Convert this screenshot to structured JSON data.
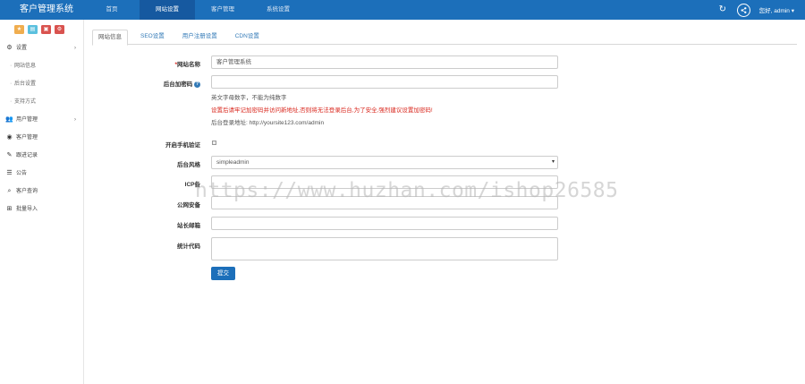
{
  "app": {
    "title": "客户管理系统",
    "user": "您好, admin ▾"
  },
  "topnav": [
    {
      "label": "首页",
      "active": false
    },
    {
      "label": "网站设置",
      "active": true
    },
    {
      "label": "客户管理",
      "active": false
    },
    {
      "label": "系统设置",
      "active": false
    }
  ],
  "quick_buttons": [
    {
      "glyph": "★",
      "color": "#f0ad4e"
    },
    {
      "glyph": "▤",
      "color": "#5bc0de"
    },
    {
      "glyph": "▣",
      "color": "#d9534f"
    },
    {
      "glyph": "⚙",
      "color": "#d9534f"
    }
  ],
  "sidebar": {
    "items": [
      {
        "label": "设置",
        "icon": "gear-icon",
        "glyph": "⚙",
        "arrow": "›",
        "type": "group"
      },
      {
        "label": "网站信息",
        "type": "sub"
      },
      {
        "label": "后台设置",
        "type": "sub"
      },
      {
        "label": "支持方式",
        "type": "sub"
      },
      {
        "label": "用户管理",
        "icon": "users-icon",
        "glyph": "👥",
        "arrow": "›",
        "type": "group"
      },
      {
        "label": "客户管理",
        "icon": "user-icon",
        "glyph": "◉",
        "type": "group"
      },
      {
        "label": "跟进记录",
        "icon": "edit-icon",
        "glyph": "✎",
        "type": "group"
      },
      {
        "label": "公告",
        "icon": "list-icon",
        "glyph": "☰",
        "type": "group"
      },
      {
        "label": "客户查询",
        "icon": "search-icon",
        "glyph": "⌕",
        "type": "group"
      },
      {
        "label": "批量导入",
        "icon": "plus-icon",
        "glyph": "⊞",
        "type": "group"
      }
    ]
  },
  "tabs": [
    {
      "label": "网站信息",
      "active": true
    },
    {
      "label": "SEO设置",
      "active": false
    },
    {
      "label": "用户注册设置",
      "active": false
    },
    {
      "label": "CDN设置",
      "active": false
    }
  ],
  "form": {
    "site_name_label": "网站名称",
    "site_name_required": "*",
    "site_name_value": "客户管理系统",
    "admin_code_label": "后台加密码",
    "admin_code_value": "",
    "hint1": "英文字母数字，不能为纯数字",
    "hint2": "设置后请牢记加密码并访问新地址,否则将无法登录后台,为了安全,强烈建议设置加密码!",
    "hint3": "后台登录地址: http://yoursite123.com/admin",
    "mobile_verify_label": "开启手机验证",
    "theme_label": "后台风格",
    "theme_value": "simpleadmin",
    "icp_label": "ICP备",
    "notice_label": "公网安备",
    "email_label": "站长邮箱",
    "stats_label": "统计代码",
    "submit_label": "提交"
  },
  "watermark": "https://www.huzhan.com/ishop26585",
  "colors": {
    "topbar": "#1c6fba",
    "active_nav": "#1659a0",
    "link": "#337ab7",
    "danger": "#d9261c"
  }
}
